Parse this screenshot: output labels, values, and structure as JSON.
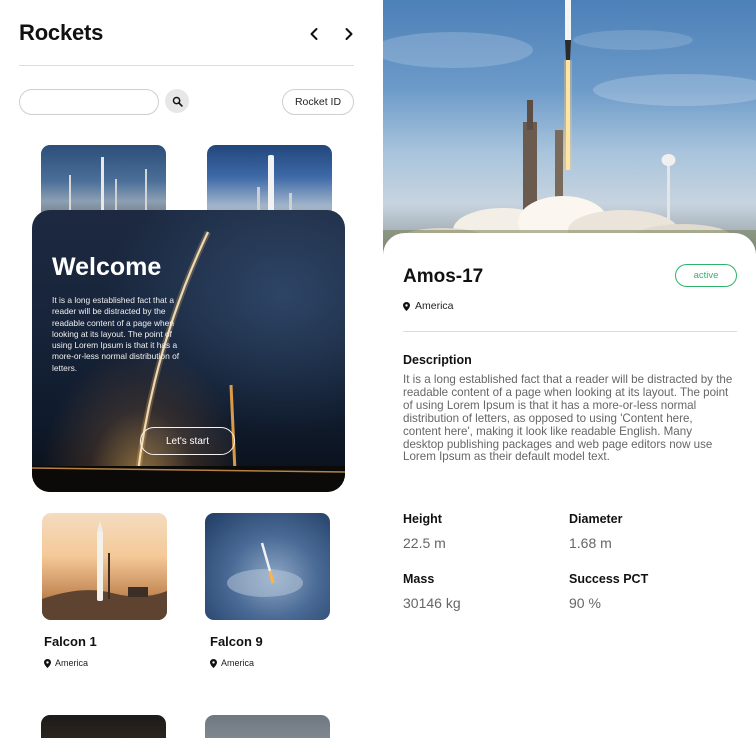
{
  "list_screen": {
    "title": "Rockets",
    "search": {
      "placeholder": "",
      "value": ""
    },
    "rocket_id_button": "Rocket ID",
    "cards": [
      {
        "name": "Falcon 1",
        "location": "America"
      },
      {
        "name": "Falcon 9",
        "location": "America"
      }
    ],
    "welcome": {
      "title": "Welcome",
      "body": "It is a long established fact that a reader will be distracted by the readable content of a page when looking at its layout. The point of using Lorem Ipsum is that it has a more-or-less normal distribution of letters.",
      "button": "Let's start"
    }
  },
  "detail_screen": {
    "title": "Amos-17",
    "status": "active",
    "location": "America",
    "description_heading": "Description",
    "description": "It is a long established fact that a reader will be distracted by the readable content of a page when looking at its layout. The point of using Lorem Ipsum is that it has a more-or-less normal distribution of letters, as opposed to using 'Content here, content here', making it look like readable English. Many desktop publishing packages and web page editors now use Lorem Ipsum as their default model text.",
    "stats": {
      "height": {
        "label": "Height",
        "value": "22.5 m"
      },
      "diameter": {
        "label": "Diameter",
        "value": "1.68 m"
      },
      "mass": {
        "label": "Mass",
        "value": "30146 kg"
      },
      "success": {
        "label": "Success PCT",
        "value": "90 %"
      }
    }
  },
  "icons": {
    "prev": "chevron-left-icon",
    "next": "chevron-right-icon",
    "search": "search-icon",
    "location": "location-pin-icon"
  },
  "colors": {
    "accent_active": "#2fb36a",
    "text_primary": "#111111",
    "text_secondary": "#666666"
  }
}
